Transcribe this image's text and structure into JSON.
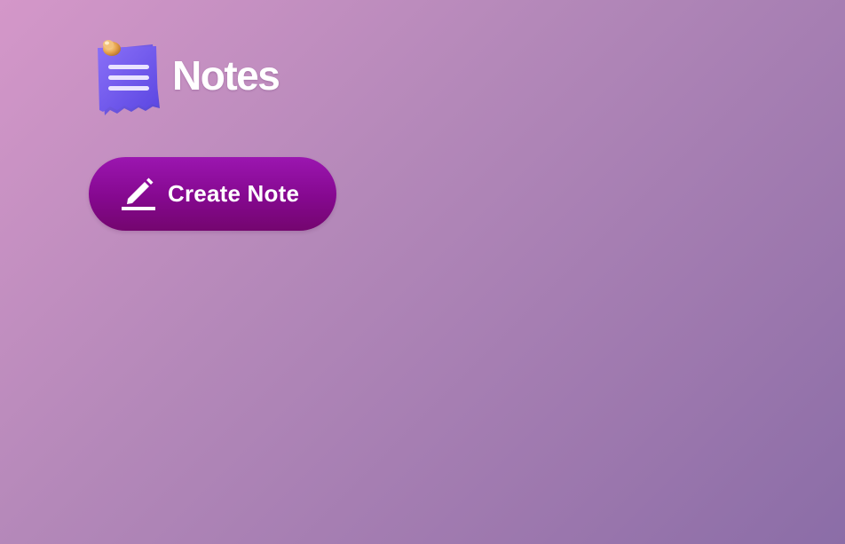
{
  "app": {
    "title": "Notes",
    "logo_icon": "notepad-with-pushpin-icon"
  },
  "actions": {
    "create_note": {
      "label": "Create Note",
      "icon": "pencil-edit-icon"
    }
  },
  "colors": {
    "background_start": "#d497c9",
    "background_end": "#8b6da7",
    "button_top": "#9b16b0",
    "button_bottom": "#74066f",
    "logo_paper": "#6b4fe6",
    "pushpin": "#e0a85a",
    "text": "#ffffff"
  }
}
